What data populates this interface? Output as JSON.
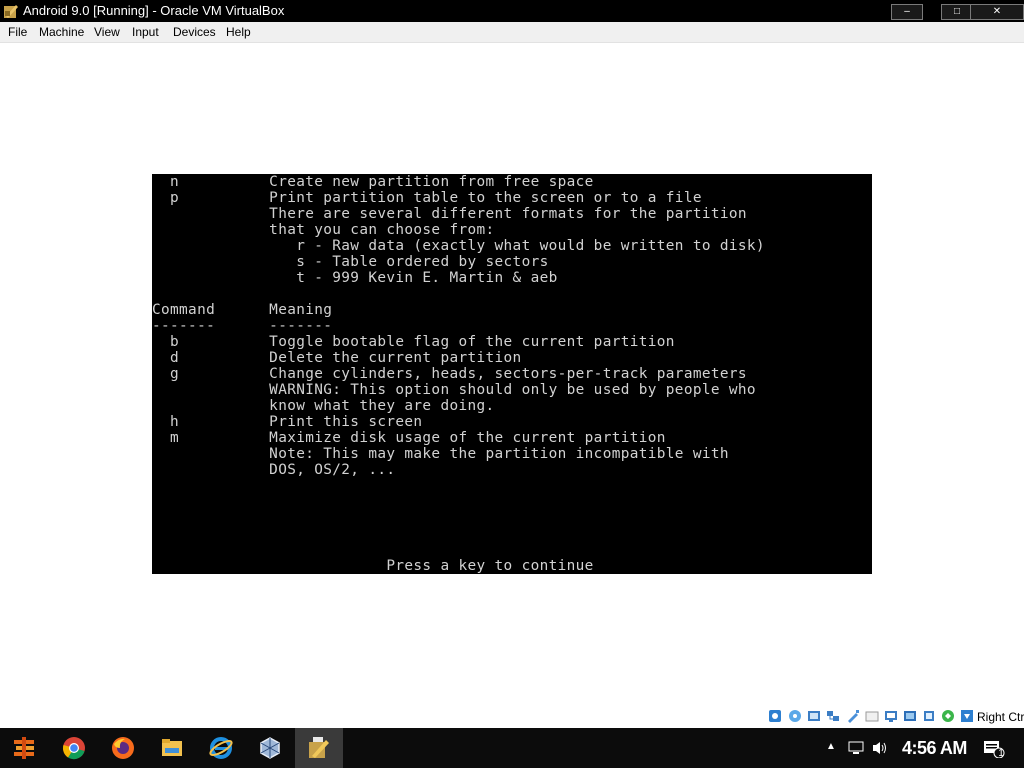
{
  "window": {
    "title": "Android 9.0 [Running] - Oracle VM VirtualBox",
    "minimize_label": "–",
    "maximize_label": "□",
    "close_label": "✕"
  },
  "menu": {
    "items": [
      "File",
      "Machine",
      "View",
      "Input",
      "Devices",
      "Help"
    ]
  },
  "console": {
    "lines": [
      "  n          Create new partition from free space",
      "  p          Print partition table to the screen or to a file",
      "             There are several different formats for the partition",
      "             that you can choose from:",
      "                r - Raw data (exactly what would be written to disk)",
      "                s - Table ordered by sectors",
      "                t - 999 Kevin E. Martin & aeb",
      "",
      "Command      Meaning",
      "-------      -------",
      "  b          Toggle bootable flag of the current partition",
      "  d          Delete the current partition",
      "  g          Change cylinders, heads, sectors-per-track parameters",
      "             WARNING: This option should only be used by people who",
      "             know what they are doing.",
      "  h          Print this screen",
      "  m          Maximize disk usage of the current partition",
      "             Note: This may make the partition incompatible with",
      "             DOS, OS/2, ...",
      "",
      "",
      "",
      "",
      "",
      "                          Press a key to continue"
    ]
  },
  "statusbar": {
    "host_key": "Right Ctrl",
    "icons": [
      "hard-disk-icon",
      "optical-drive-icon",
      "audio-icon",
      "network-icon",
      "usb-icon",
      "shared-folders-icon",
      "display-icon",
      "video-capture-icon",
      "cpu-icon",
      "mouse-integration-icon",
      "keyboard-capture-icon"
    ]
  },
  "taskbar": {
    "apps": [
      "start-button",
      "chrome-icon",
      "firefox-icon",
      "file-explorer-icon",
      "internet-explorer-icon",
      "virtualbox-icon",
      "virtualbox-vm-icon"
    ],
    "clock": "4:56 AM",
    "notification_count": "1"
  }
}
